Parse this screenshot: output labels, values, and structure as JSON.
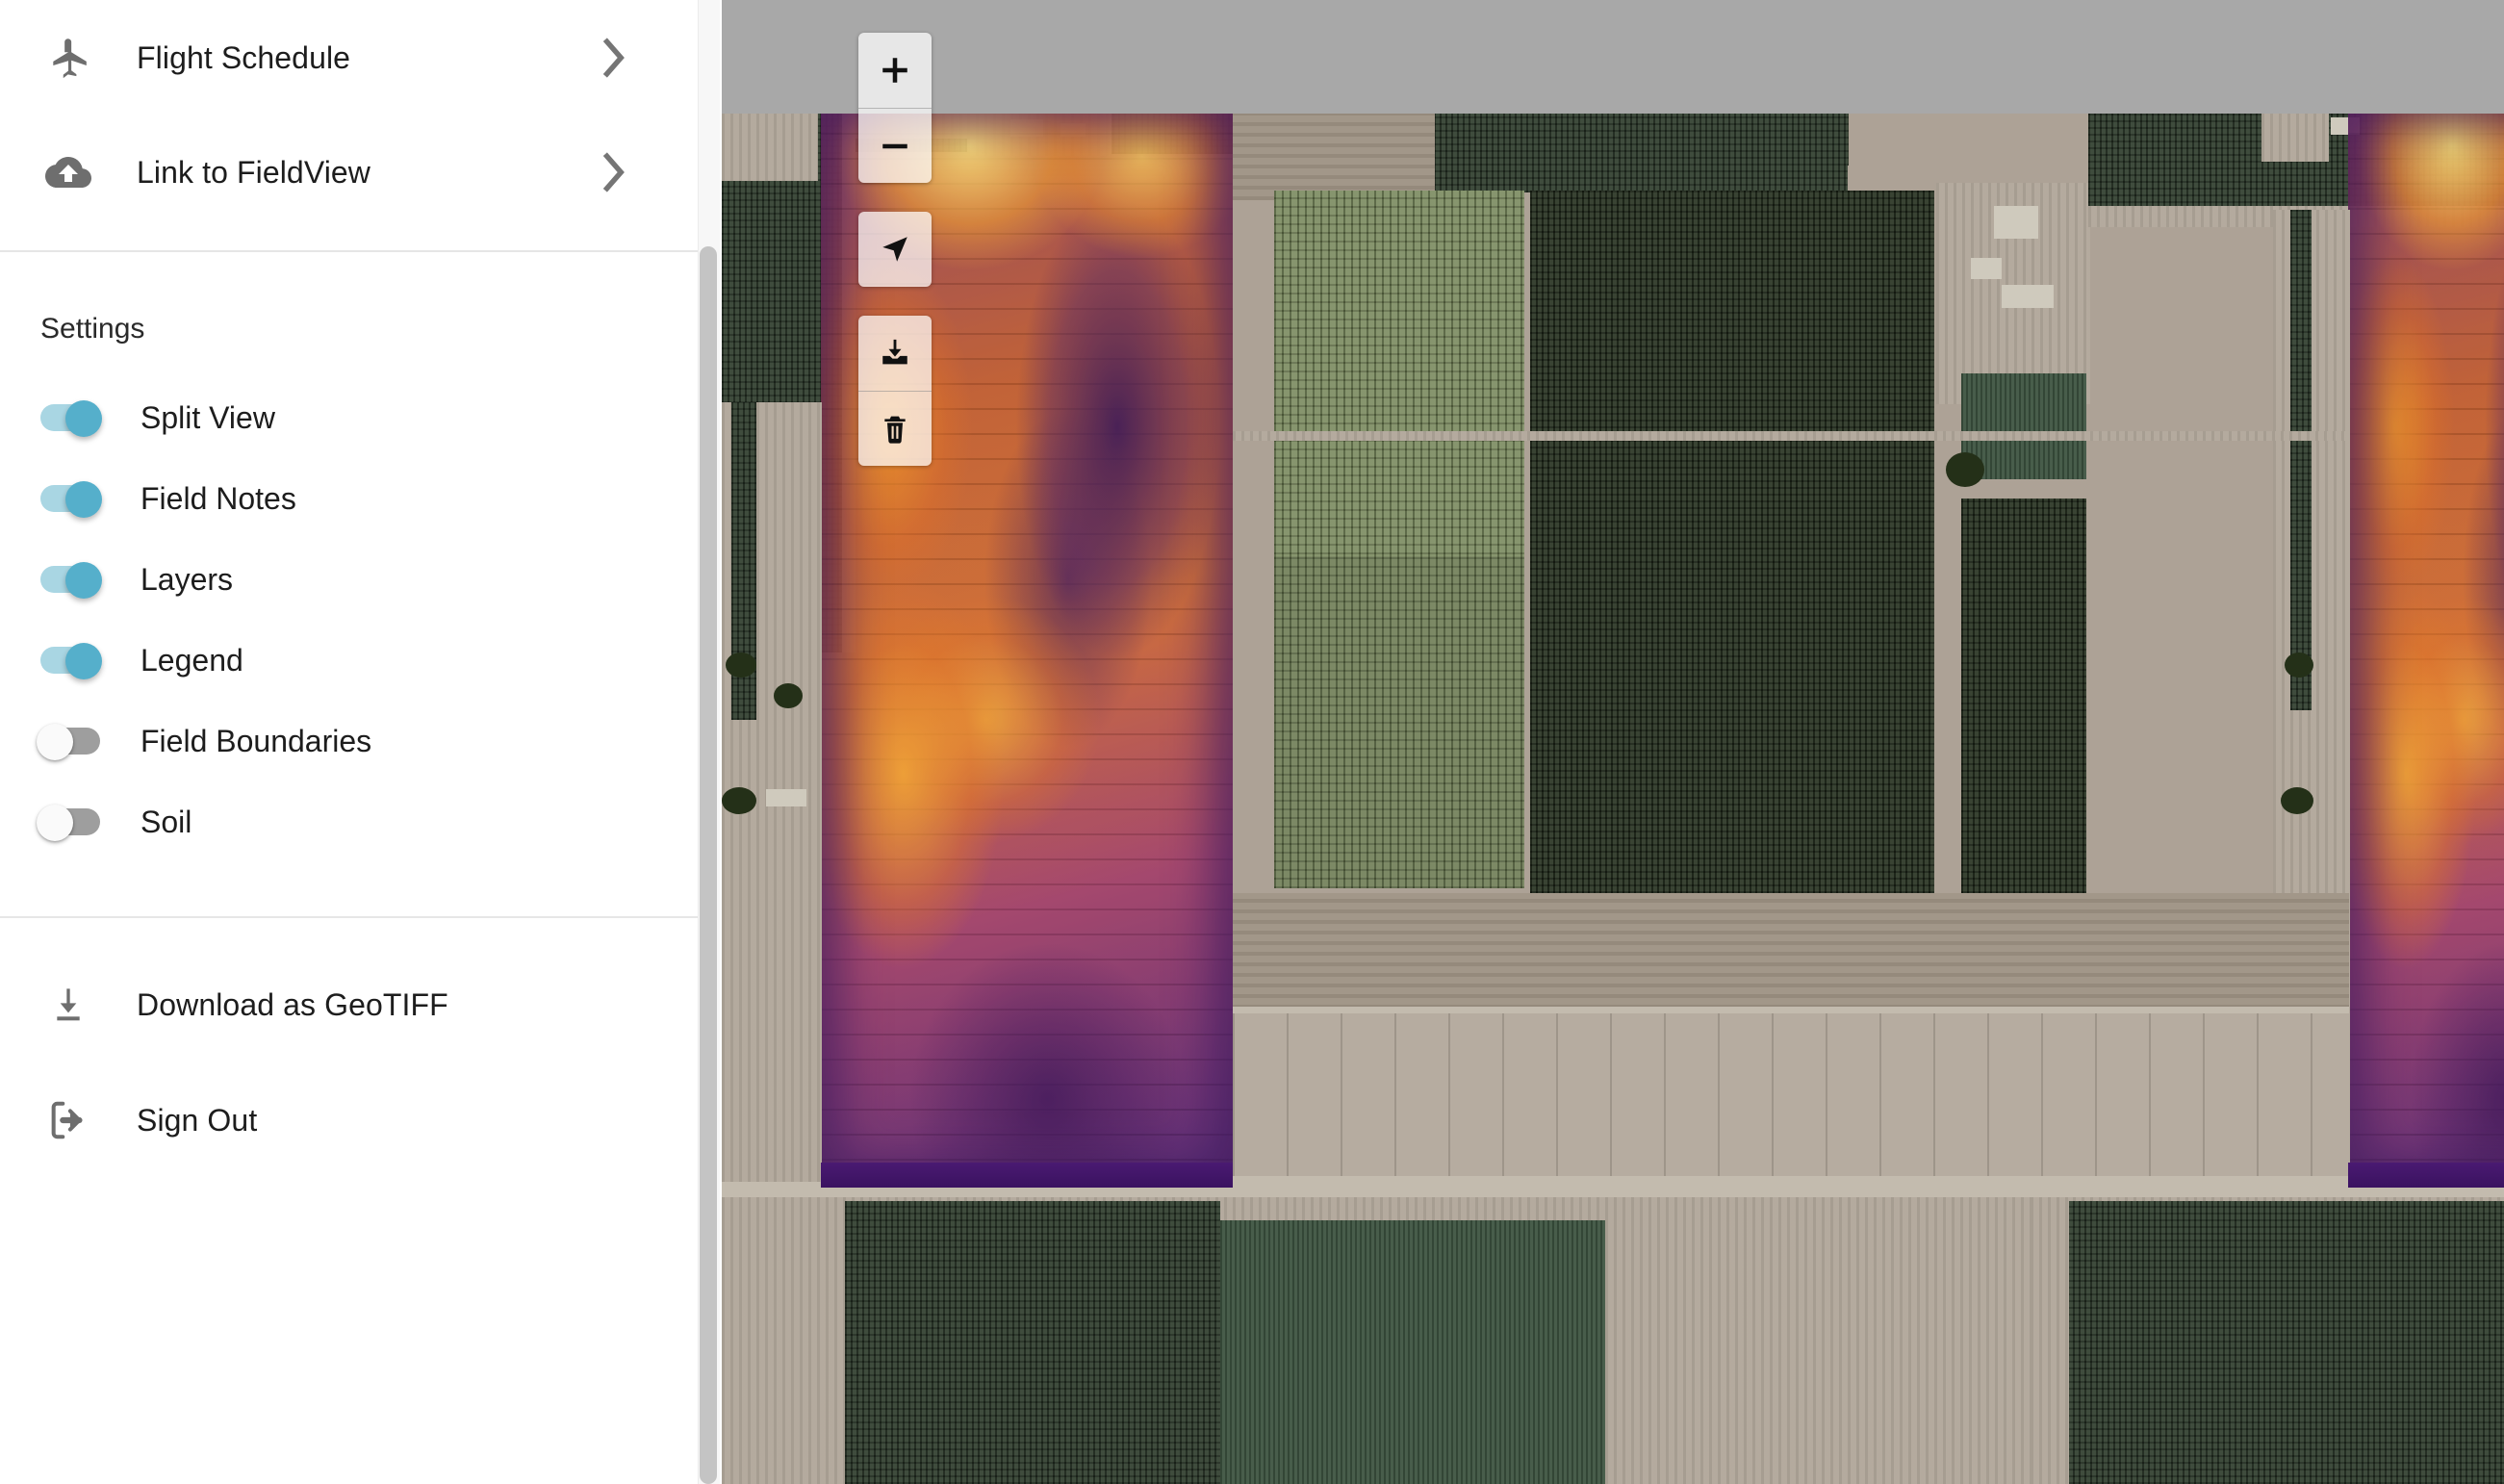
{
  "sidebar": {
    "menu_items": [
      {
        "label": "Flight Schedule",
        "icon": "airplane-icon",
        "chevron": "chevron-right-icon"
      },
      {
        "label": "Link to FieldView",
        "icon": "cloud-upload-icon",
        "chevron": "chevron-right-icon"
      }
    ],
    "settings": {
      "title": "Settings",
      "toggles": [
        {
          "label": "Split View",
          "state": "on"
        },
        {
          "label": "Field Notes",
          "state": "on"
        },
        {
          "label": "Layers",
          "state": "on"
        },
        {
          "label": "Legend",
          "state": "on"
        },
        {
          "label": "Field Boundaries",
          "state": "off"
        },
        {
          "label": "Soil",
          "state": "off"
        }
      ]
    },
    "actions": [
      {
        "label": "Download as GeoTIFF",
        "icon": "download-icon"
      },
      {
        "label": "Sign Out",
        "icon": "sign-out-icon"
      }
    ],
    "scrollbar": {
      "name": "sidebar-scrollbar"
    }
  },
  "map": {
    "controls": [
      {
        "name": "zoom-in-button",
        "icon": "plus-icon",
        "group": 1
      },
      {
        "name": "zoom-out-button",
        "icon": "minus-icon",
        "group": 1
      },
      {
        "name": "locate-button",
        "icon": "navigate-icon",
        "group": 2
      },
      {
        "name": "download-button",
        "icon": "download-tray-icon",
        "group": 3
      },
      {
        "name": "delete-button",
        "icon": "trash-icon",
        "group": 3
      }
    ],
    "layer": "satellite-imagery-with-ndvi-heatmap-overlay"
  },
  "colors": {
    "toggle_on_track": "#a9d6e3",
    "toggle_on_thumb": "#55afcb",
    "toggle_off_track": "#9e9e9e",
    "toggle_off_thumb": "#fafafa",
    "text": "#1d1d1d",
    "icon": "#6e6e6e",
    "divider": "#e6e6e6",
    "map_top_band": "#a8a8a8"
  }
}
